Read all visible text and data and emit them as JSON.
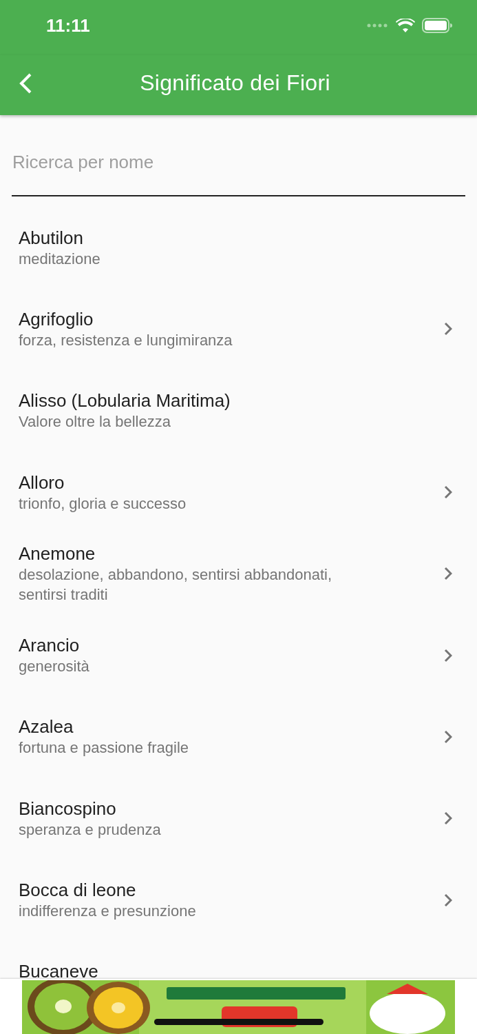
{
  "status_bar": {
    "time": "11:11"
  },
  "app_bar": {
    "title": "Significato dei Fiori"
  },
  "search": {
    "placeholder": "Ricerca per nome"
  },
  "flowers": [
    {
      "name": "Abutilon",
      "meaning": "meditazione",
      "has_detail": false
    },
    {
      "name": "Agrifoglio",
      "meaning": "forza, resistenza e lungimiranza",
      "has_detail": true
    },
    {
      "name": "Alisso (Lobularia Maritima)",
      "meaning": "Valore oltre la bellezza",
      "has_detail": false
    },
    {
      "name": "Alloro",
      "meaning": "trionfo, gloria e successo",
      "has_detail": true
    },
    {
      "name": "Anemone",
      "meaning": "desolazione, abbandono, sentirsi abbandonati, sentirsi traditi",
      "has_detail": true
    },
    {
      "name": "Arancio",
      "meaning": "generosità",
      "has_detail": true
    },
    {
      "name": "Azalea",
      "meaning": "fortuna e passione fragile",
      "has_detail": true
    },
    {
      "name": "Biancospino",
      "meaning": "speranza e prudenza",
      "has_detail": true
    },
    {
      "name": "Bocca di leone",
      "meaning": "indifferenza e presunzione",
      "has_detail": true
    },
    {
      "name": "Bucaneve"
    }
  ]
}
